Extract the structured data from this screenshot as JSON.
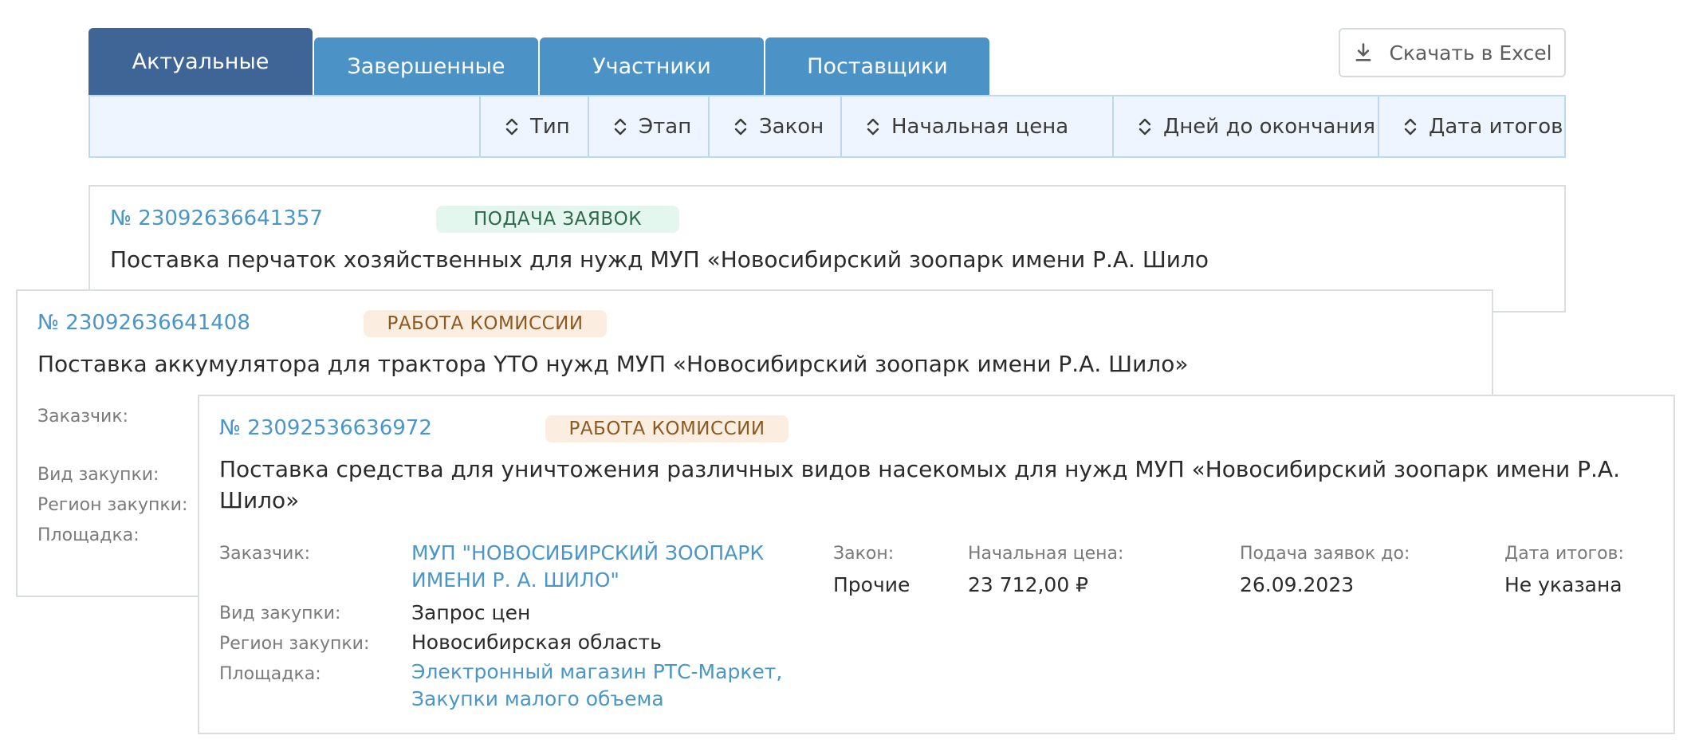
{
  "tabs": [
    {
      "label": "Актуальные",
      "active": true
    },
    {
      "label": "Завершенные",
      "active": false
    },
    {
      "label": "Участники",
      "active": false
    },
    {
      "label": "Поставщики",
      "active": false
    }
  ],
  "export_button": {
    "label": "Скачать в Excel",
    "icon": "download-icon"
  },
  "sort_columns": [
    "Тип",
    "Этап",
    "Закон",
    "Начальная цена",
    "Дней до окончания",
    "Дата итогов"
  ],
  "colors": {
    "tab": "#4b93c7",
    "tab_active": "#3f6597",
    "link": "#4a96c8",
    "badge_green_bg": "#e4f7ee",
    "badge_orange_bg": "#fbeee0"
  },
  "cards": [
    {
      "number": "№ 23092636641357",
      "status": "ПОДАЧА ЗАЯВОК",
      "title": "Поставка перчаток хозяйственных для нужд МУП «Новосибирский зоопарк имени Р.А. Шило"
    },
    {
      "number": "№ 23092636641408",
      "status": "РАБОТА КОМИССИИ",
      "title": "Поставка аккумулятора для трактора YTO нужд МУП «Новосибирский зоопарк имени Р.А. Шило»",
      "labels": {
        "customer": "Заказчик:",
        "purchase_type": "Вид закупки:",
        "region": "Регион закупки:",
        "platform": "Площадка:"
      }
    },
    {
      "number": "№ 23092536636972",
      "status": "РАБОТА КОМИССИИ",
      "title_line1": "Поставка средства для уничтожения различных видов насекомых для нужд МУП «Новосибирский зоопарк имени Р.А.",
      "title_line2": "Шило»",
      "labels": {
        "customer": "Заказчик:",
        "purchase_type": "Вид закупки:",
        "region": "Регион закупки:",
        "platform": "Площадка:",
        "law": "Закон:",
        "start_price": "Начальная цена:",
        "deadline": "Подача заявок до:",
        "results_date": "Дата итогов:"
      },
      "customer_line1": "МУП \"НОВОСИБИРСКИЙ ЗООПАРК",
      "customer_line2": "ИМЕНИ Р. А. ШИЛО\"",
      "purchase_type": "Запрос цен",
      "region": "Новосибирская область",
      "platform_line1": "Электронный магазин РТС-Маркет,",
      "platform_line2": "Закупки малого объема",
      "law": "Прочие",
      "start_price": "23 712,00 ₽",
      "deadline": "26.09.2023",
      "results_date": "Не указана"
    }
  ]
}
